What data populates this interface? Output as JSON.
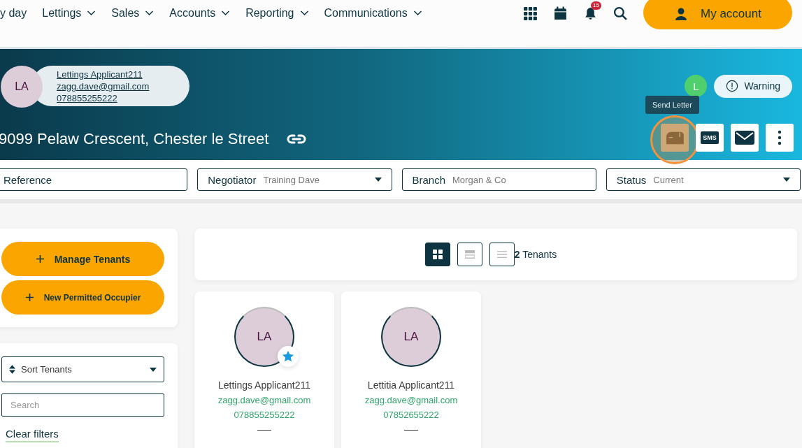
{
  "nav": {
    "items": [
      {
        "label": "y day",
        "dropdown": false
      },
      {
        "label": "Lettings",
        "dropdown": true
      },
      {
        "label": "Sales",
        "dropdown": true
      },
      {
        "label": "Accounts",
        "dropdown": true
      },
      {
        "label": "Reporting",
        "dropdown": true
      },
      {
        "label": "Communications",
        "dropdown": true
      }
    ],
    "notification_count": "15",
    "account_button": "My account"
  },
  "header": {
    "contact": {
      "initials": "LA",
      "name": "Lettings Applicant211",
      "email": "zagg.dave@gmail.com",
      "phone": "078855255222"
    },
    "address": "9099 Pelaw Crescent, Chester le Street",
    "user_badge": "L",
    "warning": "Warning",
    "tooltip": "Send Letter",
    "actions": [
      {
        "kind": "letter",
        "highlighted": true
      },
      {
        "kind": "sms",
        "label": "SMS",
        "highlighted": false
      },
      {
        "kind": "mail",
        "highlighted": false
      },
      {
        "kind": "more",
        "highlighted": false
      }
    ]
  },
  "filters": [
    {
      "label": "Reference",
      "dropdown": false
    },
    {
      "label": "Negotiator",
      "value": "Training Dave",
      "dropdown": true
    },
    {
      "label": "Branch",
      "value": "Morgan & Co",
      "dropdown": false
    },
    {
      "label": "Status",
      "value": "Current",
      "dropdown": true
    }
  ],
  "sidebar": {
    "buttons": [
      "Manage Tenants",
      "New Permitted Occupier"
    ],
    "sort": "Sort Tenants",
    "search": {
      "placeholder": "Search"
    },
    "clear_link": "Clear filters"
  },
  "view_toggles": [
    {
      "kind": "grid",
      "selected": true
    },
    {
      "kind": "rows",
      "selected": false
    },
    {
      "kind": "list",
      "selected": false
    }
  ],
  "tenant_count": "**2** Tenants",
  "tenants": [
    {
      "initials": "LA",
      "name": "Lettings Applicant211",
      "email": "zagg.dave@gmail.com",
      "phone": "078855255222",
      "lead": true
    },
    {
      "initials": "LA",
      "name": "Lettitia Applicant211",
      "email": "zagg.dave@gmail.com",
      "phone": "07852655222",
      "lead": false
    }
  ]
}
